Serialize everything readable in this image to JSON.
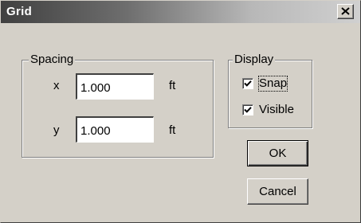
{
  "window": {
    "title": "Grid",
    "close_glyph": "✕",
    "close_icon": "close-icon"
  },
  "spacing": {
    "legend": "Spacing",
    "x": {
      "label": "x",
      "value": "1.000",
      "unit": "ft"
    },
    "y": {
      "label": "y",
      "value": "1.000",
      "unit": "ft"
    }
  },
  "display": {
    "legend": "Display",
    "snap": {
      "label": "Snap",
      "checked": true
    },
    "visible": {
      "label": "Visible",
      "checked": true
    }
  },
  "buttons": {
    "ok_label": "OK",
    "cancel_label": "Cancel"
  },
  "colors": {
    "face": "#d4d0c8",
    "titlebar_start": "#404040",
    "titlebar_end": "#d0d0d0"
  }
}
